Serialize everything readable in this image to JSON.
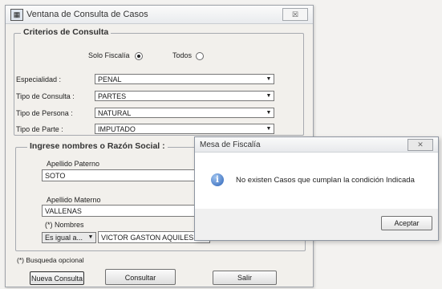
{
  "window": {
    "title": "Ventana de Consulta de Casos",
    "close_glyph": "☒"
  },
  "criterios": {
    "legend": "Criterios de Consulta",
    "radio_fiscalia_label": "Solo Fiscalía",
    "radio_todos_label": "Todos",
    "selected": "Solo Fiscalía",
    "fields": [
      {
        "label": "Especialidad :",
        "value": "PENAL"
      },
      {
        "label": "Tipo de Consulta :",
        "value": "PARTES"
      },
      {
        "label": "Tipo de Persona :",
        "value": "NATURAL"
      },
      {
        "label": "Tipo de Parte :",
        "value": "IMPUTADO"
      }
    ]
  },
  "nombres": {
    "legend": "Ingrese nombres o Razón Social :",
    "apellido_paterno_label": "Apellido Paterno",
    "apellido_paterno_value": "SOTO",
    "apellido_materno_label": "Apellido Materno",
    "apellido_materno_value": "VALLENAS",
    "nombres_label": "(*) Nombres",
    "match_select_value": "Es igual a...",
    "nombres_value": "VICTOR GASTON AQUILES"
  },
  "footer": {
    "optional_note": "(*) Busqueda opcional",
    "nueva_consulta_label": "Nueva Consulta",
    "consultar_label": "Consultar",
    "salir_label": "Salir"
  },
  "message_box": {
    "title": "Mesa de Fiscalía",
    "close_glyph": "✕",
    "icon_glyph": "i",
    "text": "No existen Casos que cumplan la condición Indicada",
    "accept_label": "Aceptar"
  }
}
